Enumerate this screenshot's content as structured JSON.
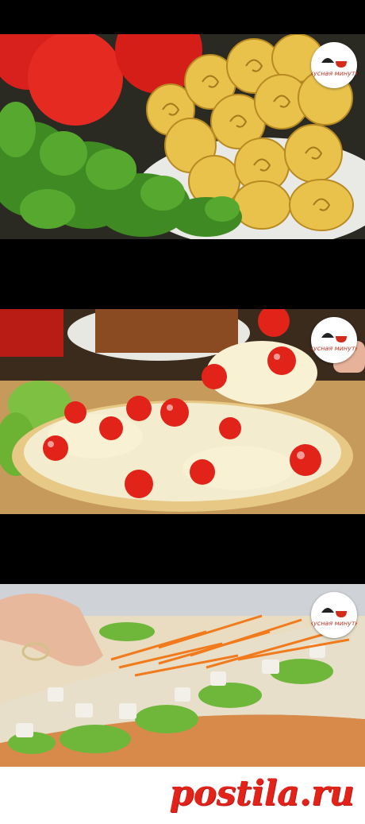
{
  "panels": [
    {
      "name": "omelette-rolls-photo",
      "logo_text": "Вкусная минутка"
    },
    {
      "name": "pizza-photo",
      "logo_text": "Вкусная минутка"
    },
    {
      "name": "lavash-roll-photo",
      "logo_text": "Вкусная минутка"
    }
  ],
  "footer": {
    "site_logo_text": "postila.ru"
  },
  "colors": {
    "brand_red": "#e2231a",
    "background": "#000000"
  }
}
